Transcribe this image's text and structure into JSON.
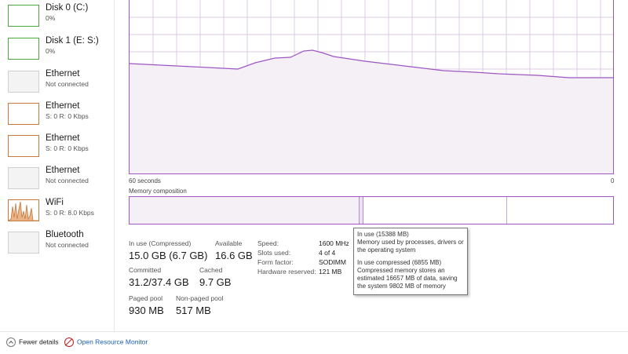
{
  "sidebar": {
    "items": [
      {
        "name": "Disk 0 (C:)",
        "sub": "0%",
        "thumb": "green"
      },
      {
        "name": "Disk 1 (E: S:)",
        "sub": "0%",
        "thumb": "green"
      },
      {
        "name": "Ethernet",
        "sub": "Not connected",
        "thumb": "gray"
      },
      {
        "name": "Ethernet",
        "sub": "S: 0 R: 0 Kbps",
        "thumb": "orange"
      },
      {
        "name": "Ethernet",
        "sub": "S: 0 R: 0 Kbps",
        "thumb": "orange"
      },
      {
        "name": "Ethernet",
        "sub": "Not connected",
        "thumb": "gray"
      },
      {
        "name": "WiFi",
        "sub": "S: 0 R: 8.0 Kbps",
        "thumb": "orange"
      },
      {
        "name": "Bluetooth",
        "sub": "Not connected",
        "thumb": "gray"
      }
    ]
  },
  "graph": {
    "axis_left": "60 seconds",
    "axis_right": "0",
    "line_color": "#9e56c2",
    "fill_color": "#f4f0f6",
    "grid_color": "#dcc9e6"
  },
  "memory_composition": {
    "label": "Memory composition"
  },
  "stats": {
    "in_use_label": "In use (Compressed)",
    "in_use_value": "15.0 GB (6.7 GB)",
    "available_label": "Available",
    "available_value": "16.6 GB",
    "committed_label": "Committed",
    "committed_value": "31.2/37.4 GB",
    "cached_label": "Cached",
    "cached_value": "9.7 GB",
    "paged_pool_label": "Paged pool",
    "paged_pool_value": "930 MB",
    "nonpaged_pool_label": "Non-paged pool",
    "nonpaged_pool_value": "517 MB"
  },
  "details": {
    "speed_label": "Speed:",
    "speed_value": "1600 MHz",
    "slots_label": "Slots used:",
    "slots_value": "4 of 4",
    "form_label": "Form factor:",
    "form_value": "SODIMM",
    "hw_label": "Hardware reserved:",
    "hw_value": "121 MB"
  },
  "tooltip": {
    "lines": [
      "In use (15388 MB)",
      "Memory used by processes, drivers or",
      "the operating system",
      "",
      "In use compressed (6855 MB)",
      "Compressed memory stores an",
      "estimated 16657 MB of data, saving",
      "the system 9802 MB of memory"
    ]
  },
  "footer": {
    "fewer_details": "Fewer details",
    "open_resource_monitor": "Open Resource Monitor"
  }
}
